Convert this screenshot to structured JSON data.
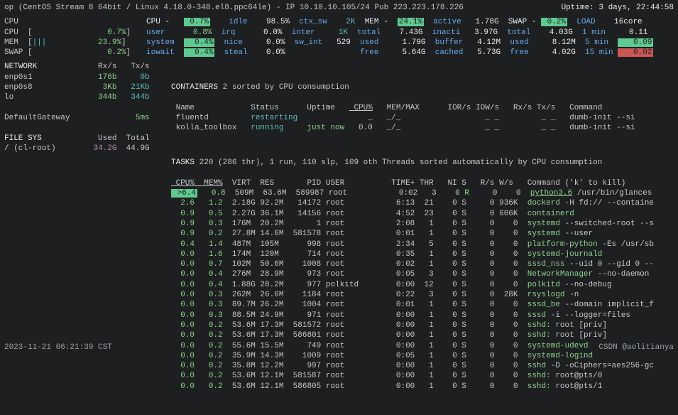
{
  "header": {
    "os": "op (CentOS Stream 8 64bit / Linux 4.18.0-348.el8.ppc64le) - IP 10.10.10.105/24 Pub 223.223.178.226",
    "uptime": "Uptime: 3 days, 22:44:58"
  },
  "top": {
    "left": [
      "CPU",
      "CPU  [              0.7%]",
      "MEM  [|||          23.9%]",
      "SWAP [              0.2%]"
    ],
    "mid": {
      "rows": [
        [
          "CPU -",
          "0.7%",
          "idle",
          "98.5%",
          "ctx_sw",
          "2K",
          "MEM -",
          "24.1%",
          "active",
          "1.78G",
          "SWAP -",
          "0.2%",
          "LOAD",
          "16core"
        ],
        [
          "user",
          "0.8%",
          "irq",
          "0.0%",
          "inter",
          "1K",
          "total",
          "7.43G",
          "inacti",
          "3.97G",
          "total",
          "4.03G",
          "1 min",
          "0.11"
        ],
        [
          "system",
          "0.4%",
          "nice",
          "0.0%",
          "sw_int",
          "529",
          "used",
          "1.79G",
          "buffer",
          "4.12M",
          "used",
          "8.12M",
          "5 min",
          "0.09"
        ],
        [
          "iowait",
          "0.4%",
          "steal",
          "0.0%",
          "",
          "",
          "free",
          "5.64G",
          "cached",
          "5.73G",
          "free",
          "4.02G",
          "15 min",
          "0.02"
        ]
      ]
    }
  },
  "network": {
    "title": "NETWORK",
    "rx": "Rx/s",
    "tx": "Tx/s",
    "rows": [
      [
        "enp0s1",
        "176b",
        "0b"
      ],
      [
        "enp0s8",
        "3Kb",
        "21Kb"
      ],
      [
        "lo",
        "344b",
        "344b"
      ]
    ],
    "gw": [
      "DefaultGateway",
      "5ms"
    ]
  },
  "fs": {
    "title": "FILE SYS",
    "used": "Used",
    "total": "Total",
    "rows": [
      [
        "/ (cl-root)",
        "34.2G",
        "44.9G"
      ]
    ]
  },
  "containers": {
    "title": "CONTAINERS",
    "subtitle": "2 sorted by CPU consumption",
    "head": [
      "Name",
      "Status",
      "Uptime",
      "CPU%",
      "MEM/MAX",
      "IOR/s IOW/s",
      "Rx/s Tx/s",
      "Command"
    ],
    "rows": [
      [
        "fluentd",
        "restarting",
        "",
        "_",
        "_/_",
        "_ _",
        "_ _",
        "dumb-init --si"
      ],
      [
        "kolla_toolbox",
        "running",
        "just now",
        "0.0",
        "_/_",
        "_ _",
        "_ _",
        "dumb-init --si"
      ]
    ]
  },
  "tasks": {
    "title": "TASKS",
    "subtitle": "220 (286 thr), 1 run, 110 slp, 109 oth Threads sorted automatically by CPU consumption",
    "head": [
      "CPU%",
      "MEM%",
      "VIRT",
      "RES",
      "PID",
      "USER",
      "TIME+",
      "THR",
      "NI",
      "S",
      "R/s",
      "W/s",
      "Command ('k' to kill)"
    ],
    "rows": [
      [
        ">6.4",
        "0.8",
        "509M",
        "63.6M",
        "589987",
        "root",
        "0:02",
        "3",
        "0",
        "R",
        "0",
        "0",
        "python3.6 /usr/bin/glances"
      ],
      [
        "2.6",
        "1.2",
        "2.18G",
        "92.2M",
        "14172",
        "root",
        "6:13",
        "21",
        "0",
        "S",
        "0",
        "936K",
        "dockerd -H fd:// --containe"
      ],
      [
        "0.9",
        "0.5",
        "2.27G",
        "36.1M",
        "14156",
        "root",
        "4:52",
        "23",
        "0",
        "S",
        "0",
        "606K",
        "containerd"
      ],
      [
        "0.9",
        "0.3",
        "176M",
        "20.2M",
        "1",
        "root",
        "2:08",
        "1",
        "0",
        "S",
        "0",
        "0",
        "systemd --switched-root --s"
      ],
      [
        "0.9",
        "0.2",
        "27.8M",
        "14.6M",
        "581578",
        "root",
        "0:01",
        "1",
        "0",
        "S",
        "0",
        "0",
        "systemd --user"
      ],
      [
        "0.4",
        "1.4",
        "487M",
        "105M",
        "998",
        "root",
        "2:34",
        "5",
        "0",
        "S",
        "0",
        "0",
        "platform-python -Es /usr/sb"
      ],
      [
        "0.0",
        "1.6",
        "174M",
        "120M",
        "714",
        "root",
        "0:35",
        "1",
        "0",
        "S",
        "0",
        "0",
        "systemd-journald"
      ],
      [
        "0.0",
        "0.7",
        "102M",
        "50.6M",
        "1008",
        "root",
        "0:02",
        "1",
        "0",
        "S",
        "0",
        "0",
        "sssd_nss --uid 0 --gid 0 --"
      ],
      [
        "0.0",
        "0.4",
        "276M",
        "28.9M",
        "973",
        "root",
        "0:05",
        "3",
        "0",
        "S",
        "0",
        "0",
        "NetworkManager --no-daemon"
      ],
      [
        "0.0",
        "0.4",
        "1.88G",
        "28.2M",
        "977",
        "polkitd",
        "0:00",
        "12",
        "0",
        "S",
        "0",
        "0",
        "polkitd --no-debug"
      ],
      [
        "0.0",
        "0.3",
        "262M",
        "26.6M",
        "1184",
        "root",
        "0:22",
        "3",
        "0",
        "S",
        "0",
        "28K",
        "rsyslogd -n"
      ],
      [
        "0.0",
        "0.3",
        "89.7M",
        "26.2M",
        "1004",
        "root",
        "0:01",
        "1",
        "0",
        "S",
        "0",
        "0",
        "sssd_be --domain implicit_f"
      ],
      [
        "0.0",
        "0.3",
        "88.5M",
        "24.9M",
        "971",
        "root",
        "0:00",
        "1",
        "0",
        "S",
        "0",
        "0",
        "sssd -i --logger=files"
      ],
      [
        "0.0",
        "0.2",
        "53.6M",
        "17.3M",
        "581572",
        "root",
        "0:00",
        "1",
        "0",
        "S",
        "0",
        "0",
        "sshd: root [priv]"
      ],
      [
        "0.0",
        "0.2",
        "53.6M",
        "17.3M",
        "586801",
        "root",
        "0:00",
        "1",
        "0",
        "S",
        "0",
        "0",
        "sshd: root [priv]"
      ],
      [
        "0.0",
        "0.2",
        "55.6M",
        "15.5M",
        "749",
        "root",
        "0:00",
        "1",
        "0",
        "S",
        "0",
        "0",
        "systemd-udevd"
      ],
      [
        "0.0",
        "0.2",
        "35.9M",
        "14.3M",
        "1009",
        "root",
        "0:05",
        "1",
        "0",
        "S",
        "0",
        "0",
        "systemd-logind"
      ],
      [
        "0.0",
        "0.2",
        "35.8M",
        "12.2M",
        "997",
        "root",
        "0:00",
        "1",
        "0",
        "S",
        "0",
        "0",
        "sshd -D -oCiphers=aes256-gc"
      ],
      [
        "0.0",
        "0.2",
        "53.6M",
        "12.1M",
        "581587",
        "root",
        "0:00",
        "1",
        "0",
        "S",
        "0",
        "0",
        "sshd: root@pts/0"
      ],
      [
        "0.0",
        "0.2",
        "53.6M",
        "12.1M",
        "586805",
        "root",
        "0:00",
        "1",
        "0",
        "S",
        "0",
        "0",
        "sshd: root@pts/1"
      ]
    ]
  },
  "footer": {
    "left": "2023-11-21 06:21:39 CST",
    "right": "CSDN @aolitianya"
  }
}
